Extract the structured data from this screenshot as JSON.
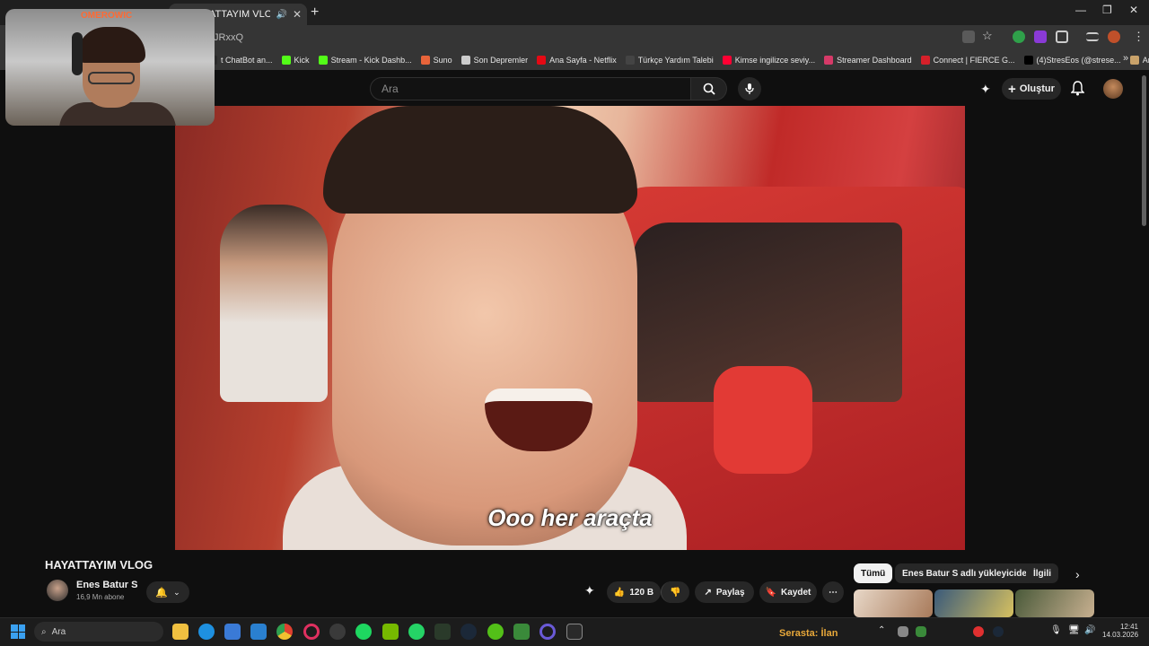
{
  "browser": {
    "tab_title": "HAYATTAYIM VLOG - YouTube",
    "address": "JRxxQ",
    "bookmarks": [
      {
        "label": "t ChatBot an...",
        "color": "#2b2b2b"
      },
      {
        "label": "Kick",
        "color": "#53fc18"
      },
      {
        "label": "Stream - Kick Dashb...",
        "color": "#53fc18"
      },
      {
        "label": "Suno",
        "color": "#e8643a"
      },
      {
        "label": "Son Depremler",
        "color": "#cccccc"
      },
      {
        "label": "Ana Sayfa - Netflix",
        "color": "#e50914"
      },
      {
        "label": "Türkçe Yardım Talebi",
        "color": "#444444"
      },
      {
        "label": "Kimse ingilizce seviy...",
        "color": "#ff0033"
      },
      {
        "label": "Streamer Dashboard",
        "color": "#d63a68"
      },
      {
        "label": "Connect | FIERCE G...",
        "color": "#d6202a"
      },
      {
        "label": "(4)StresEos (@strese...",
        "color": "#000000"
      },
      {
        "label": "Anasayfa",
        "color": "#c9a26a"
      }
    ],
    "bookmarks_more": "»"
  },
  "webcam": {
    "name": "OMEROWIC"
  },
  "youtube": {
    "search_placeholder": "Ara",
    "create_label": "Oluştur",
    "video": {
      "subtitle": "Ooo her araçta",
      "title": "HAYATTAYIM VLOG",
      "channel": "Enes Batur S",
      "subscribers": "16,9 Mn abone",
      "likes": "120 B",
      "share": "Paylaş",
      "save": "Kaydet"
    },
    "chips": [
      "Tümü",
      "Enes Batur S adlı yükleyiciden",
      "İlgili"
    ]
  },
  "taskbar": {
    "search": "Ara",
    "overlay_text": "Serasta: İlan",
    "time": "12:41",
    "date": "14.03.2026"
  }
}
